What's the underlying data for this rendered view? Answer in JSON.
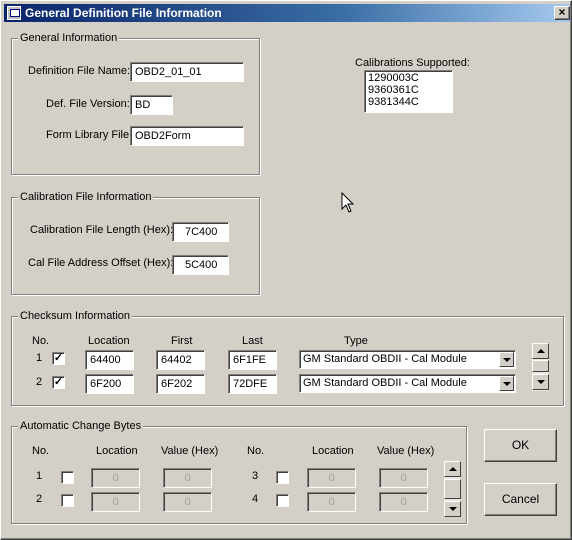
{
  "window": {
    "title": "General Definition File Information",
    "close_label": "×"
  },
  "general_info": {
    "group_label": "General Information",
    "def_file_name_label": "Definition File Name:",
    "def_file_name_value": "OBD2_01_01",
    "def_file_version_label": "Def. File Version:",
    "def_file_version_value": "BD",
    "form_library_label": "Form Library File:",
    "form_library_value": "OBD2Form"
  },
  "calibrations": {
    "label": "Calibrations Supported:",
    "items": [
      "1290003C",
      "9360361C",
      "9381344C"
    ]
  },
  "calibration_file": {
    "group_label": "Calibration File Information",
    "length_label": "Calibration File Length (Hex):",
    "length_value": "7C400",
    "offset_label": "Cal File Address Offset (Hex):",
    "offset_value": "5C400"
  },
  "checksum": {
    "group_label": "Checksum Information",
    "headers": {
      "no": "No.",
      "location": "Location",
      "first": "First",
      "last": "Last",
      "type": "Type"
    },
    "rows": [
      {
        "no": "1",
        "checked": "✓",
        "location": "64400",
        "first": "64402",
        "last": "6F1FE",
        "type": "GM Standard OBDII - Cal Module"
      },
      {
        "no": "2",
        "checked": "✓",
        "location": "6F200",
        "first": "6F202",
        "last": "72DFE",
        "type": "GM Standard OBDII - Cal Module"
      }
    ]
  },
  "auto_change": {
    "group_label": "Automatic Change Bytes",
    "headers": {
      "no": "No.",
      "location": "Location",
      "value": "Value (Hex)"
    },
    "rows": [
      {
        "no": "1",
        "location": "0",
        "value": "0"
      },
      {
        "no": "2",
        "location": "0",
        "value": "0"
      },
      {
        "no": "3",
        "location": "0",
        "value": "0"
      },
      {
        "no": "4",
        "location": "0",
        "value": "0"
      }
    ]
  },
  "buttons": {
    "ok": "OK",
    "cancel": "Cancel"
  }
}
